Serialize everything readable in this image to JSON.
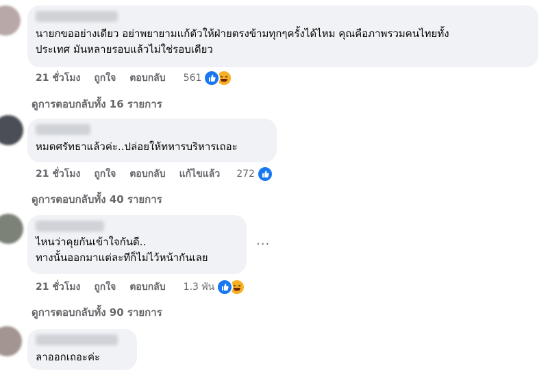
{
  "comments": [
    {
      "text": "นายกขออย่างเดียว อย่าพยายามแก้ตัวให้ฝ่ายตรงข้ามทุกๆครั้งได้ไหม คุณคือภาพรวมคนไทยทั้ง\nประเทศ มันหลายรอบแล้วไม่ใช่รอบเดียว",
      "time": "21 ชั่วโมง",
      "like": "ถูกใจ",
      "reply": "ตอบกลับ",
      "reaction_count": "561",
      "reactions": [
        "like-icon",
        "haha-icon"
      ],
      "replies": "ดูการตอบกลับทั้ง 16 รายการ"
    },
    {
      "text": "หมดศรัทธาแล้วค่ะ..ปล่อยให้ทหารบริหารเถอะ",
      "time": "21 ชั่วโมง",
      "like": "ถูกใจ",
      "reply": "ตอบกลับ",
      "edited": "แก้ไขแล้ว",
      "reaction_count": "272",
      "reactions": [
        "like-icon"
      ],
      "replies": "ดูการตอบกลับทั้ง 40 รายการ"
    },
    {
      "text": "ไหนว่าคุยกันเข้าใจกันดี..\nทางนั้นออกมาแต่ละทีก็ไม่ไว้หน้ากันเลย",
      "time": "21 ชั่วโมง",
      "like": "ถูกใจ",
      "reply": "ตอบกลับ",
      "reaction_count": "1.3 พัน",
      "reactions": [
        "like-icon",
        "haha-icon"
      ],
      "replies": "ดูการตอบกลับทั้ง 90 รายการ",
      "more": "···"
    },
    {
      "text": "ลาออกเถอะค่ะ"
    }
  ],
  "colors": {
    "bubble": "#f0f2f5",
    "meta": "#65676b",
    "like": "#1877f2",
    "haha": "#f7b125"
  }
}
